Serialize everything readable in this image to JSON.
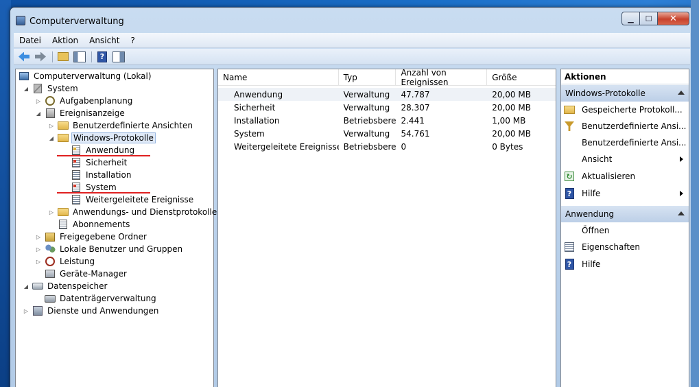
{
  "window": {
    "title": "Computerverwaltung",
    "caption": {
      "minimize": "▁",
      "maximize": "☐",
      "close": "✕"
    }
  },
  "menubar": [
    "Datei",
    "Aktion",
    "Ansicht",
    "?"
  ],
  "toolbar": {
    "icons": [
      "back-arrow-icon",
      "forward-arrow-icon",
      "folder-up-icon",
      "show-hide-tree-icon",
      "help-icon",
      "show-hide-action-pane-icon"
    ]
  },
  "tree": {
    "items": [
      {
        "label": "Computerverwaltung (Lokal)",
        "level": 0,
        "expander": "",
        "icon": "computer-icon"
      },
      {
        "label": "System",
        "level": 1,
        "expander": "◢",
        "icon": "tools-icon"
      },
      {
        "label": "Aufgabenplanung",
        "level": 2,
        "expander": "▷",
        "icon": "clock-icon"
      },
      {
        "label": "Ereignisanzeige",
        "level": 2,
        "expander": "◢",
        "icon": "event-viewer-icon"
      },
      {
        "label": "Benutzerdefinierte Ansichten",
        "level": 3,
        "expander": "▷",
        "icon": "folder-icon"
      },
      {
        "label": "Windows-Protokolle",
        "level": 3,
        "expander": "◢",
        "icon": "folder-icon",
        "selected": true
      },
      {
        "label": "Anwendung",
        "level": 4,
        "expander": "",
        "icon": "log-icon"
      },
      {
        "label": "Sicherheit",
        "level": 4,
        "expander": "",
        "icon": "log-icon"
      },
      {
        "label": "Installation",
        "level": 4,
        "expander": "",
        "icon": "log-icon"
      },
      {
        "label": "System",
        "level": 4,
        "expander": "",
        "icon": "log-icon"
      },
      {
        "label": "Weitergeleitete Ereignisse",
        "level": 4,
        "expander": "",
        "icon": "log-icon"
      },
      {
        "label": "Anwendungs- und Dienstprotokolle",
        "level": 3,
        "expander": "▷",
        "icon": "folder-icon"
      },
      {
        "label": "Abonnements",
        "level": 3,
        "expander": "",
        "icon": "log-icon"
      },
      {
        "label": "Freigegebene Ordner",
        "level": 2,
        "expander": "▷",
        "icon": "shared-folder-icon"
      },
      {
        "label": "Lokale Benutzer und Gruppen",
        "level": 2,
        "expander": "▷",
        "icon": "users-icon"
      },
      {
        "label": "Leistung",
        "level": 2,
        "expander": "▷",
        "icon": "performance-icon"
      },
      {
        "label": "Geräte-Manager",
        "level": 2,
        "expander": "",
        "icon": "device-manager-icon"
      },
      {
        "label": "Datenspeicher",
        "level": 1,
        "expander": "◢",
        "icon": "storage-icon"
      },
      {
        "label": "Datenträgerverwaltung",
        "level": 2,
        "expander": "",
        "icon": "disk-icon"
      },
      {
        "label": "Dienste und Anwendungen",
        "level": 1,
        "expander": "▷",
        "icon": "services-icon"
      }
    ]
  },
  "list": {
    "columns": [
      "Name",
      "Typ",
      "Anzahl von Ereignissen",
      "Größe"
    ],
    "rows": [
      [
        "Anwendung",
        "Verwaltung",
        "47.787",
        "20,00 MB"
      ],
      [
        "Sicherheit",
        "Verwaltung",
        "28.307",
        "20,00 MB"
      ],
      [
        "Installation",
        "Betriebsbereit",
        "2.441",
        "1,00 MB"
      ],
      [
        "System",
        "Verwaltung",
        "54.761",
        "20,00 MB"
      ],
      [
        "Weitergeleitete Ereignisse",
        "Betriebsbereit",
        "0",
        "0 Bytes"
      ]
    ]
  },
  "actions": {
    "title": "Aktionen",
    "section1": "Windows-Protokolle",
    "section1_items": [
      "Gespeicherte Protokoll...",
      "Benutzerdefinierte Ansi...",
      "Benutzerdefinierte Ansi...",
      "Ansicht",
      "Aktualisieren",
      "Hilfe"
    ],
    "section2": "Anwendung",
    "section2_items": [
      "Öffnen",
      "Eigenschaften",
      "Hilfe"
    ]
  },
  "annotation_color": "#e02020"
}
